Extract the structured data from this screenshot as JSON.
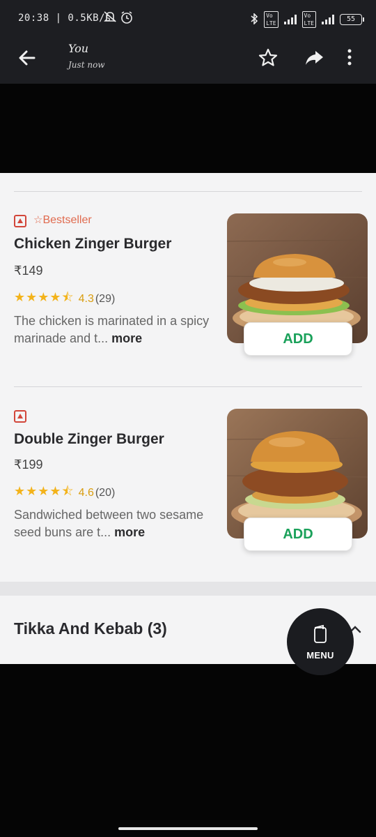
{
  "status_bar": {
    "time": "20:38 | 0.5KB/s",
    "battery": "55"
  },
  "header": {
    "title": "You",
    "subtitle": "Just now"
  },
  "items": [
    {
      "badge": "Bestseller",
      "name": "Chicken Zinger Burger",
      "price": "₹149",
      "stars": "★★★★⯪",
      "rating": "4.3",
      "rating_count": "(29)",
      "description": "The chicken is marinated in a spicy marinade and t...",
      "more_label": "more",
      "add_label": "ADD"
    },
    {
      "badge": "",
      "name": "Double Zinger Burger",
      "price": "₹199",
      "stars": "★★★★⯪",
      "rating": "4.6",
      "rating_count": "(20)",
      "description": "Sandwiched between two sesame seed buns are t...",
      "more_label": "more",
      "add_label": "ADD"
    }
  ],
  "section": {
    "title": "Tikka And Kebab (3)"
  },
  "menu_fab": {
    "label": "MENU"
  },
  "colors": {
    "accent_green": "#1aa15a",
    "bestseller": "#e06a4e",
    "star": "#f3b31b",
    "topbar": "#1d1e22"
  }
}
